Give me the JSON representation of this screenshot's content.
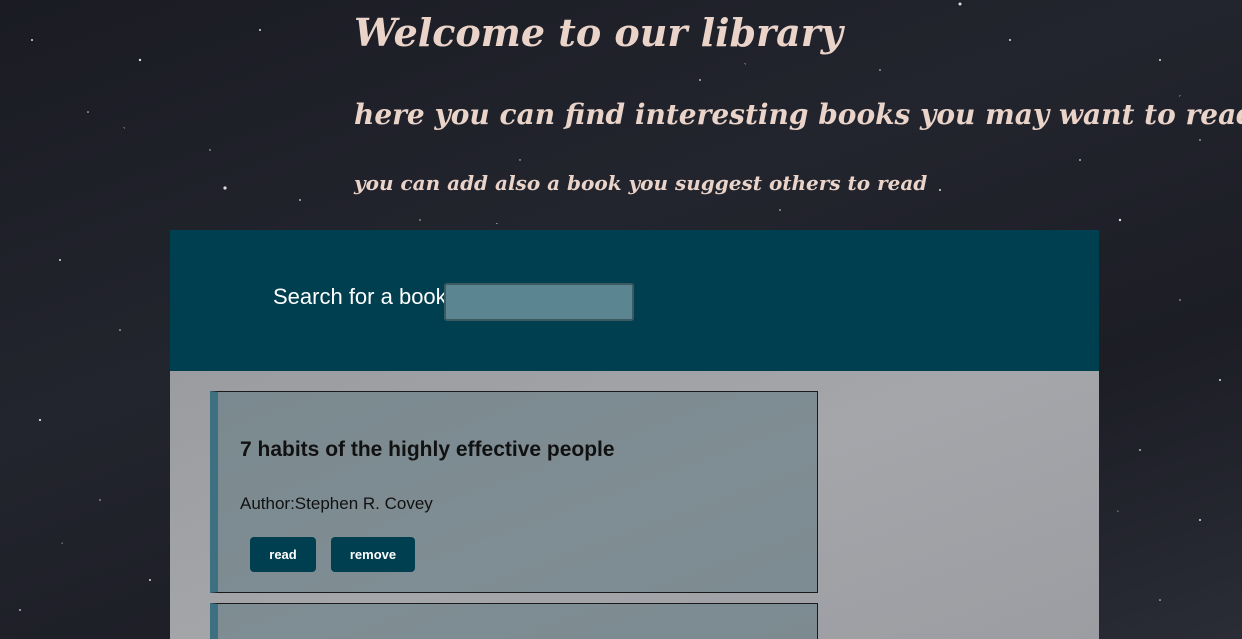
{
  "header": {
    "title": "Welcome to our library",
    "subtitle": "here you can find interesting books you may want to read",
    "tagline": "you can add also a book you suggest others to read"
  },
  "search": {
    "label": "Search for a book",
    "value": "",
    "placeholder": ""
  },
  "books": [
    {
      "title": "7 habits of the highly effective people",
      "author": "Author:Stephen R. Covey",
      "read_label": "read",
      "remove_label": "remove"
    }
  ],
  "colors": {
    "panel": "#003f50",
    "heading_text": "#ead3c8",
    "card_accent": "#3d7080",
    "button_bg": "#003f50"
  }
}
